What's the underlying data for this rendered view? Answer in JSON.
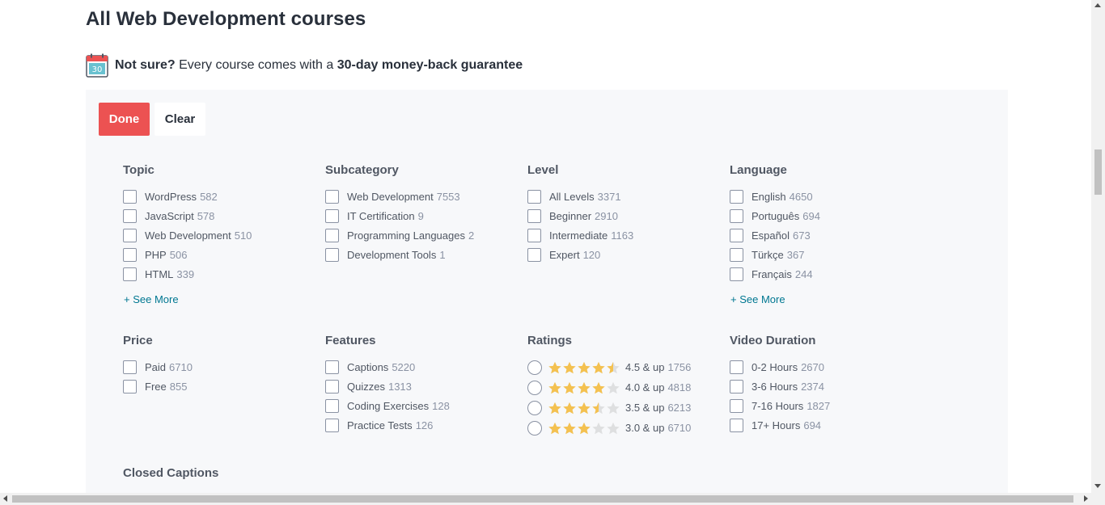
{
  "page": {
    "title": "All Web Development courses"
  },
  "guarantee": {
    "icon": "calendar-30-icon",
    "icon_text": "30",
    "lead": "Not sure?",
    "middle": " Every course comes with a ",
    "bold": "30-day money-back guarantee"
  },
  "actions": {
    "done_label": "Done",
    "clear_label": "Clear"
  },
  "filters": {
    "topic": {
      "title": "Topic",
      "options": [
        {
          "label": "WordPress",
          "count": "582"
        },
        {
          "label": "JavaScript",
          "count": "578"
        },
        {
          "label": "Web Development",
          "count": "510"
        },
        {
          "label": "PHP",
          "count": "506"
        },
        {
          "label": "HTML",
          "count": "339"
        }
      ],
      "see_more": "+ See More"
    },
    "subcategory": {
      "title": "Subcategory",
      "options": [
        {
          "label": "Web Development",
          "count": "7553"
        },
        {
          "label": "IT Certification",
          "count": "9"
        },
        {
          "label": "Programming Languages",
          "count": "2"
        },
        {
          "label": "Development Tools",
          "count": "1"
        }
      ]
    },
    "level": {
      "title": "Level",
      "options": [
        {
          "label": "All Levels",
          "count": "3371"
        },
        {
          "label": "Beginner",
          "count": "2910"
        },
        {
          "label": "Intermediate",
          "count": "1163"
        },
        {
          "label": "Expert",
          "count": "120"
        }
      ]
    },
    "language": {
      "title": "Language",
      "options": [
        {
          "label": "English",
          "count": "4650"
        },
        {
          "label": "Português",
          "count": "694"
        },
        {
          "label": "Español",
          "count": "673"
        },
        {
          "label": "Türkçe",
          "count": "367"
        },
        {
          "label": "Français",
          "count": "244"
        }
      ],
      "see_more": "+ See More"
    },
    "price": {
      "title": "Price",
      "options": [
        {
          "label": "Paid",
          "count": "6710"
        },
        {
          "label": "Free",
          "count": "855"
        }
      ]
    },
    "features": {
      "title": "Features",
      "options": [
        {
          "label": "Captions",
          "count": "5220"
        },
        {
          "label": "Quizzes",
          "count": "1313"
        },
        {
          "label": "Coding Exercises",
          "count": "128"
        },
        {
          "label": "Practice Tests",
          "count": "126"
        }
      ]
    },
    "ratings": {
      "title": "Ratings",
      "options": [
        {
          "rating": 4.5,
          "label": "4.5 & up",
          "count": "1756"
        },
        {
          "rating": 4.0,
          "label": "4.0 & up",
          "count": "4818"
        },
        {
          "rating": 3.5,
          "label": "3.5 & up",
          "count": "6213"
        },
        {
          "rating": 3.0,
          "label": "3.0 & up",
          "count": "6710"
        }
      ]
    },
    "video_duration": {
      "title": "Video Duration",
      "options": [
        {
          "label": "0-2 Hours",
          "count": "2670"
        },
        {
          "label": "3-6 Hours",
          "count": "2374"
        },
        {
          "label": "7-16 Hours",
          "count": "1827"
        },
        {
          "label": "17+ Hours",
          "count": "694"
        }
      ]
    },
    "closed_captions": {
      "title": "Closed Captions"
    }
  },
  "colors": {
    "accent": "#ec5252",
    "link": "#007791",
    "star": "#f4c150",
    "star_empty": "#dedfe0",
    "panel_bg": "#f7f8fa"
  }
}
